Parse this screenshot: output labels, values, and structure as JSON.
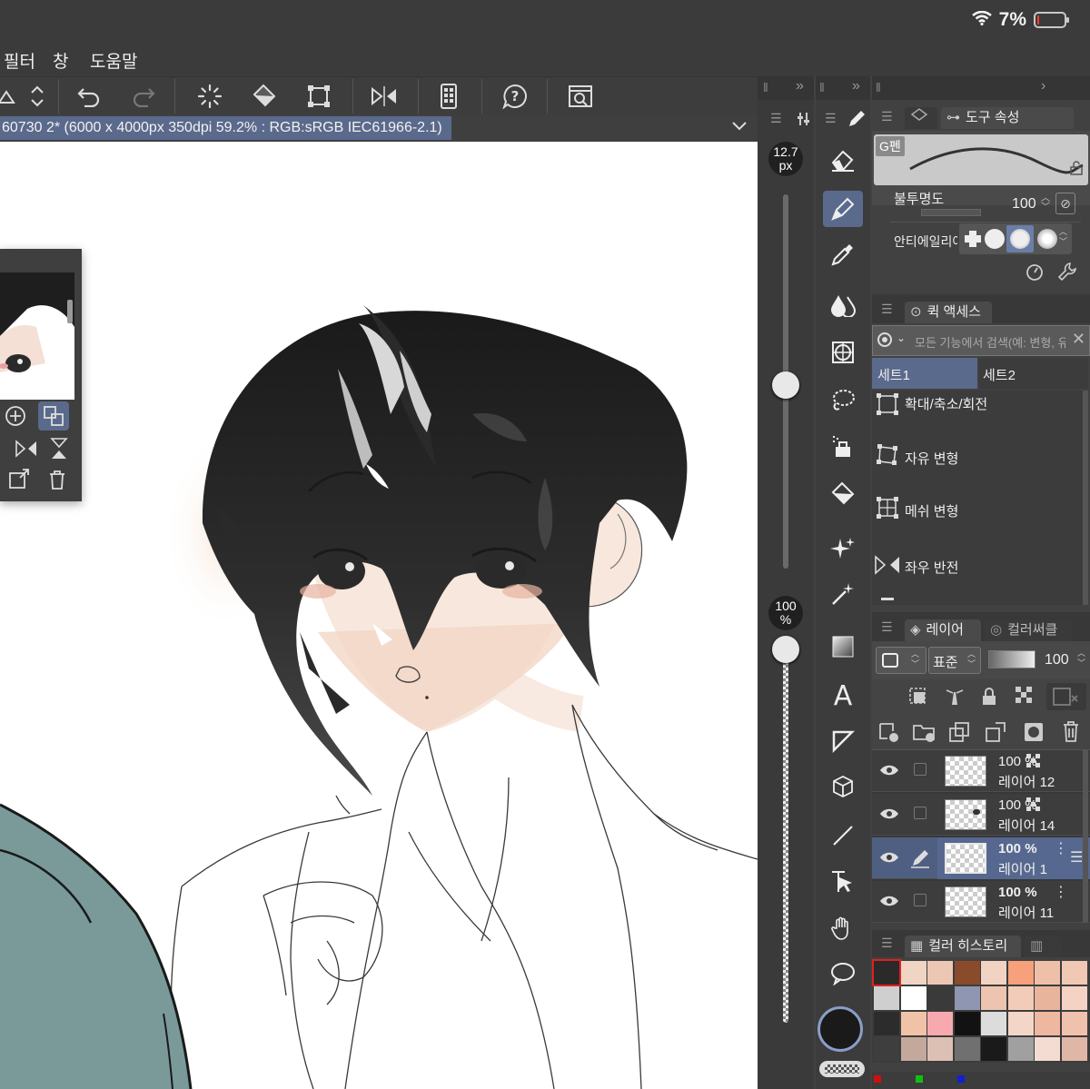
{
  "status": {
    "battery": "7%",
    "battery_level": 0.07
  },
  "menu": {
    "filter": "필터",
    "window": "창",
    "help": "도움말"
  },
  "document": {
    "title": "60730 2* (6000 x 4000px 350dpi 59.2% : RGB:sRGB IEC61966-2.1)"
  },
  "brush_size": {
    "value": "12.7",
    "unit": "px"
  },
  "opacity_slider": {
    "value": "100",
    "unit": "%"
  },
  "tool_property": {
    "tab_label": "도구 속성",
    "brush_name": "G펜",
    "opacity_label": "불투명도",
    "opacity_value": "100",
    "antialias_label": "안티에일리어싱"
  },
  "quick_access": {
    "tab_label": "퀵 액세스",
    "search_placeholder": "모든 기능에서 검색(예: 변형, 유채색",
    "set1": "세트1",
    "set2": "세트2",
    "items": [
      "확대/축소/회전",
      "자유 변형",
      "메쉬 변형",
      "좌우 반전"
    ]
  },
  "layer_panel": {
    "tab_label": "레이어",
    "tab2_label": "컬러써클",
    "blend_mode": "표준",
    "opacity": "100",
    "layers": [
      {
        "opacity": "100 %",
        "name": "레이어 12",
        "selected": false
      },
      {
        "opacity": "100 %",
        "name": "레이어 14",
        "selected": false
      },
      {
        "opacity": "100 %",
        "name": "레이어 1",
        "selected": true
      },
      {
        "opacity": "100 %",
        "name": "레이어 11",
        "selected": false
      }
    ]
  },
  "color_history": {
    "tab_label": "컬러 히스토리",
    "colors": [
      "#2a2a2a",
      "#f0d4c4",
      "#ecc8b4",
      "#8a4a2c",
      "#f2d2c2",
      "#f6a07c",
      "#eec0a8",
      "#f0c8b4",
      "#cfcfcf",
      "#ffffff",
      "#3a3a3a",
      "#8e96b2",
      "#ecc4b0",
      "#f2ccb8",
      "#e8b49c",
      "#f4d2c4",
      "#2c2c2c",
      "#f0c2a8",
      "#f6aab0",
      "#121212",
      "#dcdcdc",
      "#f4d6c8",
      "#eeb8a0",
      "#f0c2ae",
      "#3e3e3e",
      "#c4a89c",
      "#dcc0b4",
      "#707070",
      "#1a1a1a",
      "#a0a0a0",
      "#f4dcd2",
      "#e0b6a6"
    ]
  }
}
